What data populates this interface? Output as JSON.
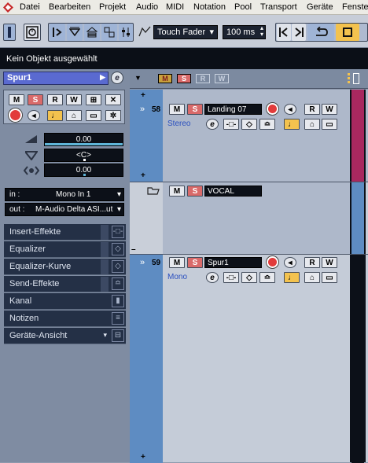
{
  "menubar": {
    "items": [
      "Datei",
      "Bearbeiten",
      "Projekt",
      "Audio",
      "MIDI",
      "Notation",
      "Pool",
      "Transport",
      "Geräte",
      "Fenste"
    ]
  },
  "toolbar": {
    "automation_mode": "Touch Fader",
    "nudge_value": "100 ms"
  },
  "status": {
    "text": "Kein Objekt ausgewählt"
  },
  "inspector": {
    "track_name": "Spur1",
    "buttons": {
      "mute": "M",
      "solo": "S",
      "read": "R",
      "write": "W",
      "edit": "e"
    },
    "volume": "0.00",
    "pan": "<C>",
    "delay": "0.00",
    "input_label": "in :",
    "input_value": "Mono In 1",
    "output_label": "out :",
    "output_value": "M-Audio Delta ASI...ut",
    "sections": [
      "Insert-Effekte",
      "Equalizer",
      "Equalizer-Kurve",
      "Send-Effekte",
      "Kanal",
      "Notizen",
      "Geräte-Ansicht"
    ]
  },
  "tracklist": {
    "header_buttons": [
      "M",
      "S",
      "R",
      "W"
    ],
    "tracks": [
      {
        "number": "58",
        "name": "Landing 07",
        "channel": "Stereo"
      },
      {
        "number": "",
        "name": "VOCAL",
        "channel": ""
      },
      {
        "number": "59",
        "name": "Spur1",
        "channel": "Mono"
      }
    ],
    "track_buttons": {
      "mute": "M",
      "solo": "S",
      "read": "R",
      "write": "W",
      "edit": "e"
    }
  },
  "colors": {
    "track_color_left": "#5e8cc2",
    "inspector_title_bg": "#5a6ad0",
    "solo_red": "#d96a6a",
    "monitor_gold": "#f3c24e",
    "record_red": "#e23b3b"
  }
}
